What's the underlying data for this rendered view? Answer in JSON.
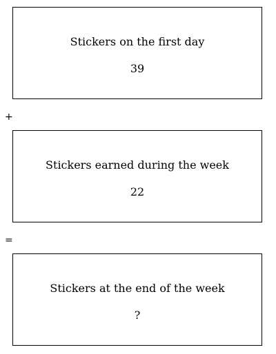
{
  "boxes": [
    {
      "label": "Stickers on the first day",
      "value": "39"
    },
    {
      "label": "Stickers earned during the week",
      "value": "22"
    },
    {
      "label": "Stickers at the end of the week",
      "value": "?"
    }
  ],
  "operators": {
    "plus": "+",
    "equals": "="
  }
}
